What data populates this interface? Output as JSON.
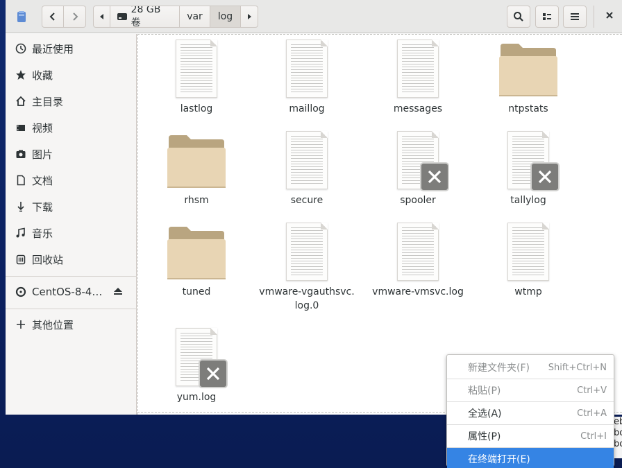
{
  "window": {
    "path_segments": [
      {
        "label": "28 GB 卷",
        "icon": "drive-icon"
      },
      {
        "label": "var"
      },
      {
        "label": "log",
        "active": true
      }
    ]
  },
  "sidebar": {
    "items": [
      {
        "label": "最近使用",
        "icon": "recent-icon"
      },
      {
        "label": "收藏",
        "icon": "star-icon"
      },
      {
        "label": "主目录",
        "icon": "home-icon"
      },
      {
        "label": "视频",
        "icon": "video-icon"
      },
      {
        "label": "图片",
        "icon": "camera-icon"
      },
      {
        "label": "文档",
        "icon": "document-icon"
      },
      {
        "label": "下载",
        "icon": "download-icon"
      },
      {
        "label": "音乐",
        "icon": "music-icon"
      },
      {
        "label": "回收站",
        "icon": "trash-icon"
      }
    ],
    "device": {
      "label": "CentOS-8-4…",
      "icon": "disc-icon"
    },
    "other": {
      "label": "其他位置",
      "icon": "plus-icon"
    }
  },
  "files": [
    {
      "name": "lastlog",
      "type": "document"
    },
    {
      "name": "maillog",
      "type": "document"
    },
    {
      "name": "messages",
      "type": "document"
    },
    {
      "name": "ntpstats",
      "type": "folder"
    },
    {
      "name": "rhsm",
      "type": "folder"
    },
    {
      "name": "secure",
      "type": "document"
    },
    {
      "name": "spooler",
      "type": "document",
      "unreadable": true
    },
    {
      "name": "tallylog",
      "type": "document",
      "unreadable": true
    },
    {
      "name": "tuned",
      "type": "folder"
    },
    {
      "name": "vmware-vgauthsvc.\nlog.0",
      "type": "document"
    },
    {
      "name": "vmware-vmsvc.log",
      "type": "document"
    },
    {
      "name": "wtmp",
      "type": "document"
    },
    {
      "name": "yum.log",
      "type": "document",
      "unreadable": true
    }
  ],
  "context_menu": {
    "items": [
      {
        "label": "新建文件夹(F)",
        "shortcut": "Shift+Ctrl+N",
        "disabled": true
      },
      {
        "label": "粘贴(P)",
        "shortcut": "Ctrl+V",
        "disabled": true
      },
      {
        "label": "全选(A)",
        "shortcut": "Ctrl+A"
      },
      {
        "label": "属性(P)",
        "shortcut": "Ctrl+I"
      },
      {
        "label": "在终端打开(E)",
        "shortcut": "",
        "highlighted": true
      }
    ]
  },
  "desktop_peek": "eb\nbo\nbo",
  "colors": {
    "accent": "#3584e4",
    "folder": "#e8d5b4",
    "folder_tab": "#b9a580",
    "desktop": "#0d2563"
  }
}
